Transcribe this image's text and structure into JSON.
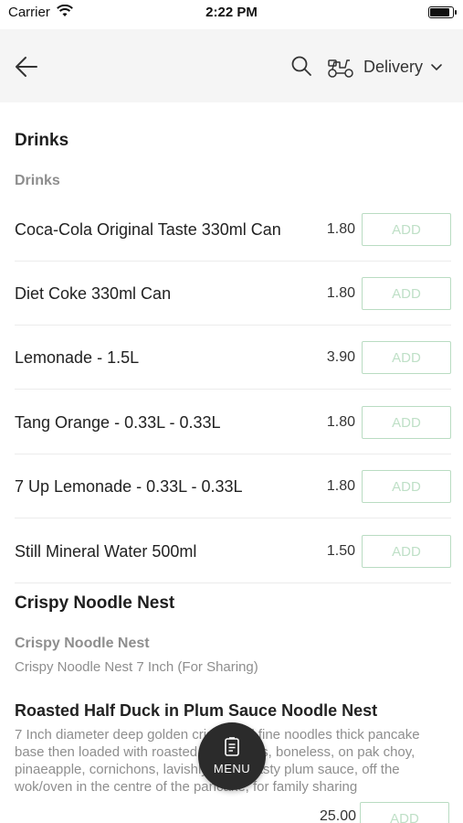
{
  "status_bar": {
    "carrier": "Carrier",
    "time": "2:22 PM",
    "battery_level": 0.9
  },
  "header": {
    "back_icon": "arrow-left-icon",
    "search_icon": "search-icon",
    "delivery_icon": "scooter-icon",
    "delivery_label": "Delivery",
    "dropdown_icon": "chevron-down-icon"
  },
  "sections": {
    "drinks": {
      "title": "Drinks",
      "subtitle": "Drinks",
      "items": [
        {
          "name": "Coca-Cola Original Taste 330ml Can",
          "price": "1.80",
          "add_label": "ADD"
        },
        {
          "name": "Diet Coke 330ml Can",
          "price": "1.80",
          "add_label": "ADD"
        },
        {
          "name": "Lemonade - 1.5L",
          "price": "3.90",
          "add_label": "ADD"
        },
        {
          "name": "Tang Orange - 0.33L - 0.33L",
          "price": "1.80",
          "add_label": "ADD"
        },
        {
          "name": "7 Up Lemonade - 0.33L - 0.33L",
          "price": "1.80",
          "add_label": "ADD"
        },
        {
          "name": "Still Mineral Water 500ml",
          "price": "1.50",
          "add_label": "ADD"
        }
      ]
    },
    "noodle": {
      "title": "Crispy Noodle Nest",
      "subtitle": "Crispy Noodle Nest",
      "description": "Crispy Noodle Nest 7 Inch (For Sharing)",
      "items": [
        {
          "name": "Roasted Half Duck in Plum Sauce Noodle Nest",
          "description": "7 Inch diameter deep golden crispy and fine noodles thick pancake base then loaded with roasted duck slices, boneless, on pak choy, pinaeapple, cornichons, lavishly sweet tasty plum sauce, off the wok/oven in the centre of the pancake, for family sharing",
          "price": "25.00",
          "add_label": "ADD"
        }
      ]
    }
  },
  "menu_button": {
    "icon": "menu-card-icon",
    "label": "MENU"
  },
  "colors": {
    "header_bg": "#f5f5f5",
    "add_border": "#b9dcc2",
    "add_text": "#bfe0c7",
    "fab_bg": "#2b2b2b",
    "muted_text": "#8e8e8e"
  }
}
